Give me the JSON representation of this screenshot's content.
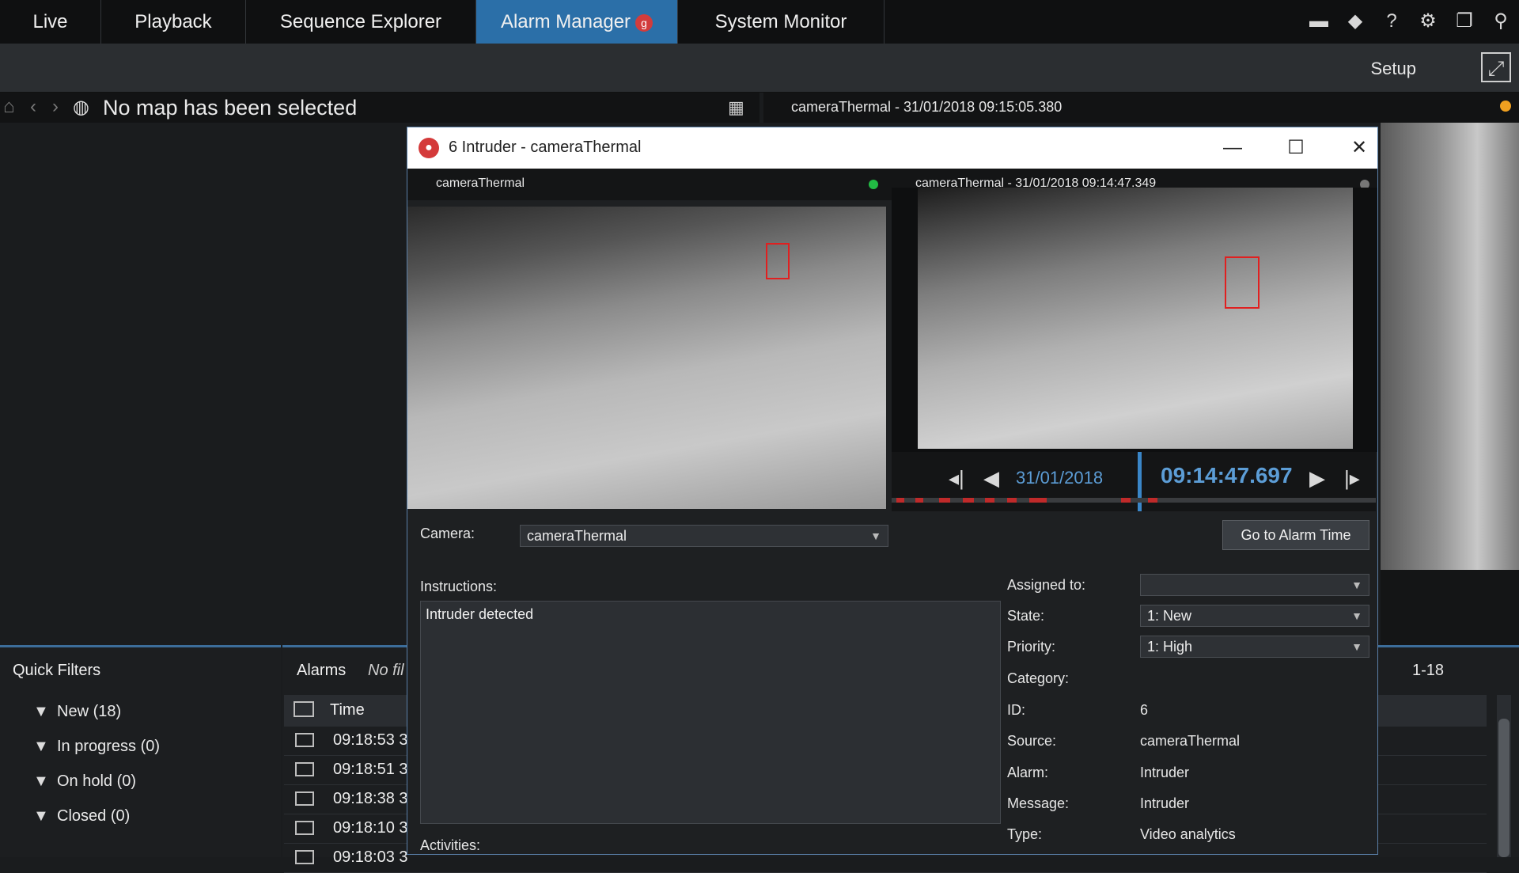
{
  "tabs": [
    {
      "label": "Live",
      "active": false
    },
    {
      "label": "Playback",
      "active": false
    },
    {
      "label": "Sequence Explorer",
      "active": false
    },
    {
      "label": "Alarm Manager",
      "active": true,
      "badge": "g"
    },
    {
      "label": "System Monitor",
      "active": false
    }
  ],
  "top_icons": [
    "network-icon",
    "broadcast-icon",
    "help-icon",
    "settings-icon",
    "windows-icon",
    "pin-icon"
  ],
  "toolbar": {
    "setup_label": "Setup"
  },
  "map": {
    "title": "No map has been selected"
  },
  "camera_view": {
    "header": "cameraThermal - 31/01/2018 09:15:05.380",
    "status_color": "#f0a020"
  },
  "dialog": {
    "title": "6 Intruder - cameraThermal",
    "live_pane": {
      "header": "cameraThermal",
      "status_color": "#22bb44"
    },
    "playback_pane": {
      "header": "cameraThermal - 31/01/2018 09:14:47.349"
    },
    "playback": {
      "date": "31/01/2018",
      "time": "09:14:47.697"
    },
    "camera_label": "Camera:",
    "camera_value": "cameraThermal",
    "go_to_alarm_label": "Go to Alarm Time",
    "instructions_label": "Instructions:",
    "instructions_text": "Intruder detected",
    "activities_label": "Activities:",
    "fields": {
      "assigned_to": {
        "label": "Assigned to:",
        "value": ""
      },
      "state": {
        "label": "State:",
        "value": "1: New"
      },
      "priority": {
        "label": "Priority:",
        "value": "1: High"
      },
      "category": {
        "label": "Category:",
        "value": ""
      },
      "id": {
        "label": "ID:",
        "value": "6"
      },
      "source": {
        "label": "Source:",
        "value": "cameraThermal"
      },
      "alarm": {
        "label": "Alarm:",
        "value": "Intruder"
      },
      "message": {
        "label": "Message:",
        "value": "Intruder"
      },
      "type": {
        "label": "Type:",
        "value": "Video analytics"
      }
    }
  },
  "quick_filters": {
    "title": "Quick Filters",
    "items": [
      "New (18)",
      "In progress (0)",
      "On hold (0)",
      "Closed (0)"
    ]
  },
  "alarms": {
    "title": "Alarms",
    "filter_text": "No fil",
    "range": "1-18",
    "column_time": "Time",
    "rows": [
      "09:18:53 3",
      "09:18:51 3",
      "09:18:38 3",
      "09:18:10 3",
      "09:18:03 3"
    ]
  }
}
